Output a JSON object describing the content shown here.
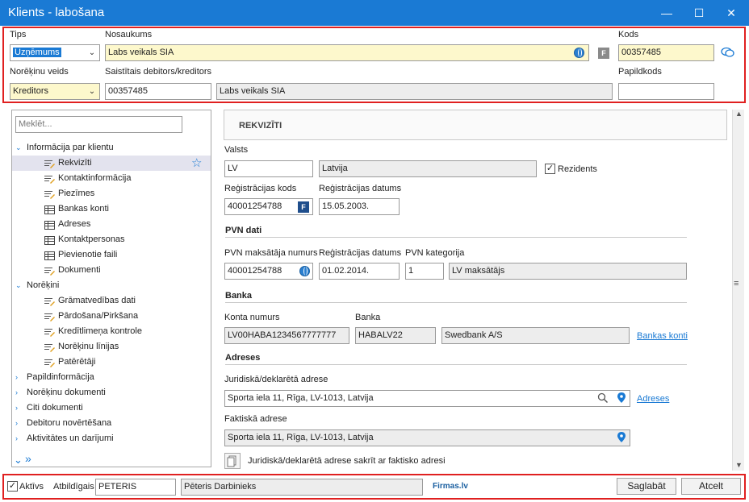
{
  "window": {
    "title": "Klients - labošana",
    "minimize": "—",
    "maximize": "☐",
    "close": "✕"
  },
  "header": {
    "tips_label": "Tips",
    "tips_value": "Uzņēmums",
    "nosaukums_label": "Nosaukums",
    "nosaukums_value": "Labs veikals SIA",
    "kods_label": "Kods",
    "kods_value": "00357485",
    "noreķinu_veids_label": "Norēķinu veids",
    "noreķinu_veids_value": "Kreditors",
    "saistitais_label": "Saistītais debitors/kreditors",
    "saistitais_code": "00357485",
    "saistitais_name": "Labs veikals SIA",
    "papildkods_label": "Papildkods",
    "papildkods_value": "",
    "f_badge": "F"
  },
  "tree": {
    "search_placeholder": "Meklēt...",
    "items": [
      {
        "label": "Informācija par klientu",
        "level": 0,
        "arrow": "⌄"
      },
      {
        "label": "Rekvizīti",
        "level": 1,
        "icon": "form"
      },
      {
        "label": "Kontaktinformācija",
        "level": 1,
        "icon": "form"
      },
      {
        "label": "Piezīmes",
        "level": 1,
        "icon": "form"
      },
      {
        "label": "Bankas konti",
        "level": 1,
        "icon": "grid"
      },
      {
        "label": "Adreses",
        "level": 1,
        "icon": "grid"
      },
      {
        "label": "Kontaktpersonas",
        "level": 1,
        "icon": "grid"
      },
      {
        "label": "Pievienotie faili",
        "level": 1,
        "icon": "grid"
      },
      {
        "label": "Dokumenti",
        "level": 1,
        "icon": "form"
      },
      {
        "label": "Norēķini",
        "level": 0,
        "arrow": "⌄"
      },
      {
        "label": "Grāmatvedības dati",
        "level": 1,
        "icon": "form"
      },
      {
        "label": "Pārdošana/Pirkšana",
        "level": 1,
        "icon": "form"
      },
      {
        "label": "Kredītlimeņa kontrole",
        "level": 1,
        "icon": "form"
      },
      {
        "label": "Norēķinu līnijas",
        "level": 1,
        "icon": "form"
      },
      {
        "label": "Patērētāji",
        "level": 1,
        "icon": "form"
      },
      {
        "label": "Papildinformācija",
        "level": 0,
        "arrow": "›"
      },
      {
        "label": "Norēķinu dokumenti",
        "level": 0,
        "arrow": "›"
      },
      {
        "label": "Citi dokumenti",
        "level": 0,
        "arrow": "›"
      },
      {
        "label": "Debitoru novērtēšana",
        "level": 0,
        "arrow": "›"
      },
      {
        "label": "Aktivitātes un darījumi",
        "level": 0,
        "arrow": "›"
      }
    ],
    "expand_icon": "»"
  },
  "panel": {
    "title": "REKVIZĪTI",
    "valsts_label": "Valsts",
    "valsts_code": "LV",
    "valsts_name": "Latvija",
    "rezidents_label": "Rezidents",
    "reg_kods_label": "Reģistrācijas kods",
    "reg_kods_value": "40001254788",
    "reg_datums_label": "Reģistrācijas datums",
    "reg_datums_value": "15.05.2003.",
    "pvn_section": "PVN dati",
    "pvn_num_label": "PVN maksātāja numurs",
    "pvn_num_value": "40001254788",
    "pvn_reg_label": "Reģistrācijas datums",
    "pvn_reg_value": "01.02.2014.",
    "pvn_kat_label": "PVN kategorija",
    "pvn_kat_value": "1",
    "pvn_kat_name": "LV maksātājs",
    "banka_section": "Banka",
    "konta_label": "Konta numurs",
    "konta_value": "LV00HABA1234567777777",
    "banka_label": "Banka",
    "banka_code": "HABALV22",
    "banka_name": "Swedbank A/S",
    "bankas_konti_link": "Bankas konti",
    "adreses_section": "Adreses",
    "jur_label": "Juridiskā/deklarētā adrese",
    "jur_value": "Sporta iela 11, Rīga, LV-1013, Latvija",
    "adreses_link": "Adreses",
    "fakt_label": "Faktiskā adrese",
    "fakt_value": "Sporta iela 11, Rīga, LV-1013, Latvija",
    "same_label": "Juridiskā/deklarētā adrese sakrīt ar faktisko adresi"
  },
  "footer": {
    "aktivs_label": "Aktīvs",
    "atbildigais_label": "Atbildīgais",
    "atbildigais_code": "PETERIS",
    "atbildigais_name": "Pēteris Darbinieks",
    "firmas_logo": "Firmas.lv",
    "save": "Saglabāt",
    "cancel": "Atcelt"
  },
  "colors": {
    "accent": "#1a7ad4",
    "frame": "#e02020",
    "yellow_field": "#fdf8cc"
  }
}
